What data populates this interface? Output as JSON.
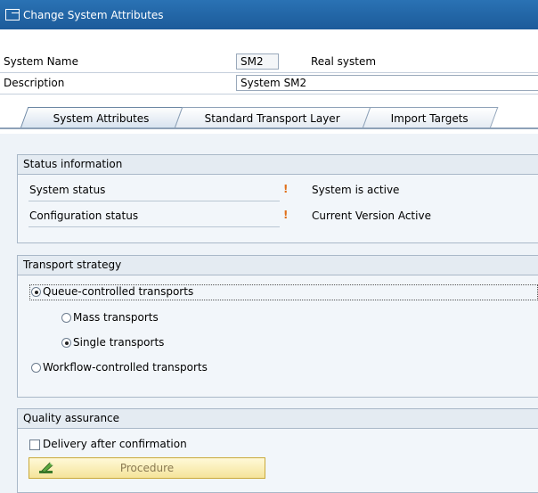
{
  "window": {
    "title": "Change System Attributes"
  },
  "header": {
    "system_name_label": "System Name",
    "system_name_value": "SM2",
    "system_type": "Real system",
    "description_label": "Description",
    "description_value": "System SM2"
  },
  "tabs": [
    {
      "label": "System Attributes",
      "active": true
    },
    {
      "label": "Standard Transport Layer",
      "active": false
    },
    {
      "label": "Import Targets",
      "active": false
    }
  ],
  "status_info": {
    "title": "Status information",
    "rows": [
      {
        "label": "System status",
        "indicator": "!",
        "value": "System is active"
      },
      {
        "label": "Configuration status",
        "indicator": "!",
        "value": "Current Version Active"
      }
    ]
  },
  "transport_strategy": {
    "title": "Transport strategy",
    "queue": {
      "label": "Queue-controlled transports",
      "selected": true
    },
    "mass": {
      "label": "Mass transports",
      "selected": false
    },
    "single": {
      "label": "Single transports",
      "selected": true
    },
    "workflow": {
      "label": "Workflow-controlled transports",
      "selected": false
    }
  },
  "quality_assurance": {
    "title": "Quality assurance",
    "delivery_label": "Delivery after confirmation",
    "delivery_checked": false,
    "procedure_button": "Procedure"
  },
  "colors": {
    "title_bar": "#1c5b9a",
    "indicator": "#e0701a",
    "button": "#f5e49a"
  }
}
